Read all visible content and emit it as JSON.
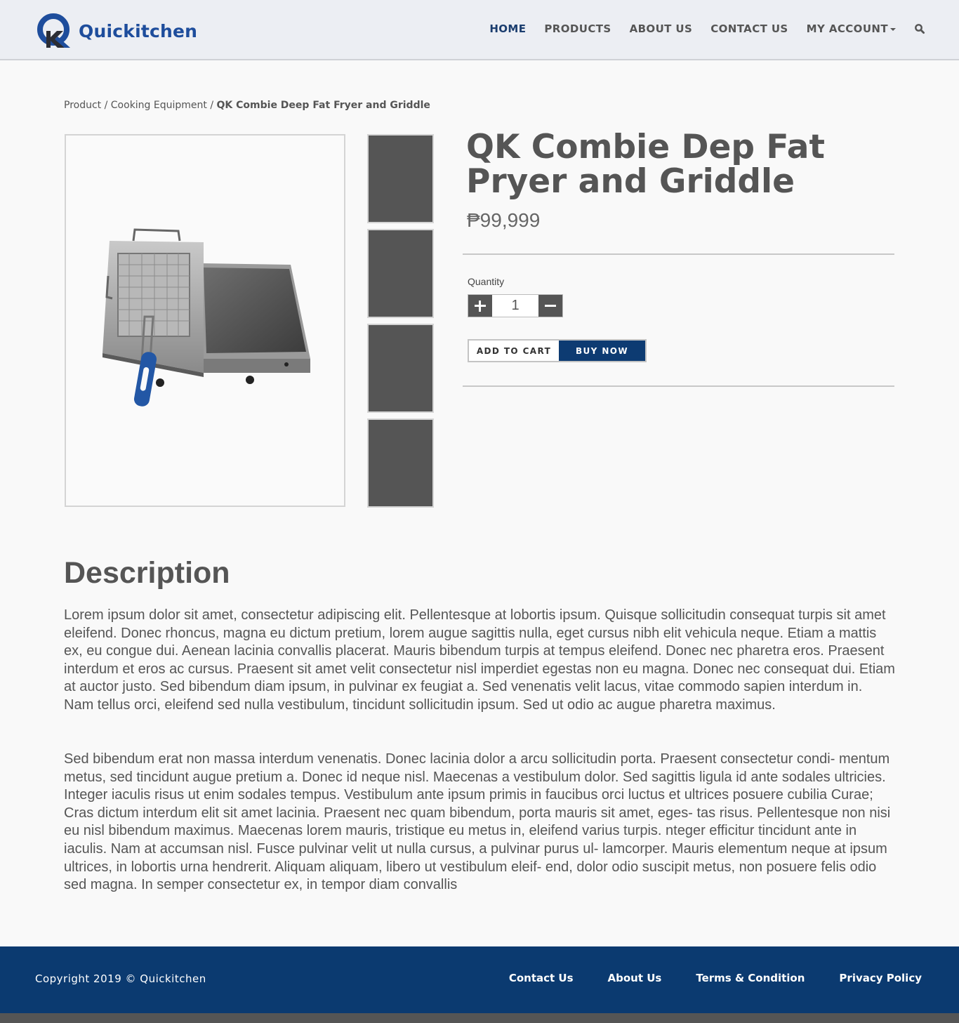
{
  "brand": {
    "name": "Quickitchen",
    "color": "#1e4d9c"
  },
  "nav": {
    "items": [
      {
        "label": "HOME",
        "active": true
      },
      {
        "label": "PRODUCTS"
      },
      {
        "label": "ABOUT US"
      },
      {
        "label": "CONTACT US"
      },
      {
        "label": "MY ACCOUNT"
      }
    ],
    "search_icon": "search-icon",
    "account_icon": "chevron-down-icon"
  },
  "breadcrumb": {
    "items": [
      "Product",
      "Cooking Equipment"
    ],
    "separator": "/",
    "current": "QK Combie Deep Fat Fryer and Griddle"
  },
  "product": {
    "title": "QK Combie Dep Fat Pryer and Griddle",
    "price": "₱99,999",
    "quantity_label": "Quantity",
    "quantity_value": "1",
    "add_to_cart_label": "ADD TO CART",
    "buy_now_label": "BUY NOW",
    "thumbnail_count": 4
  },
  "description": {
    "heading": "Description",
    "paragraphs": [
      "Lorem ipsum dolor sit amet, consectetur adipiscing elit. Pellentesque at lobortis ipsum. Quisque sollicitudin consequat turpis sit amet eleifend. Donec rhoncus, magna eu dictum pretium, lorem augue sagittis nulla, eget cursus nibh elit vehicula neque. Etiam a mattis ex, eu congue dui. Aenean lacinia convallis placerat. Mauris bibendum turpis at tempus eleifend. Donec nec pharetra eros. Praesent interdum et eros ac cursus. Praesent sit amet velit consectetur nisl imperdiet egestas non eu magna. Donec nec consequat dui. Etiam at auctor justo. Sed bibendum diam ipsum, in pulvinar ex feugiat a. Sed venenatis velit lacus, vitae commodo sapien interdum in. Nam tellus orci, eleifend sed nulla vestibulum, tincidunt sollicitudin ipsum. Sed ut odio ac augue pharetra maximus.",
      "Sed bibendum erat non massa interdum venenatis. Donec lacinia dolor a arcu sollicitudin porta. Praesent consectetur condi- mentum metus, sed tincidunt augue pretium a. Donec id neque nisl. Maecenas a vestibulum dolor. Sed sagittis ligula id ante sodales ultricies. Integer iaculis risus ut enim sodales tempus. Vestibulum ante ipsum primis in faucibus orci luctus et ultrices posuere cubilia Curae; Cras dictum interdum elit sit amet lacinia. Praesent nec quam bibendum, porta mauris sit amet, eges- tas risus. Pellentesque non nisi eu nisl bibendum maximus. Maecenas lorem mauris, tristique eu metus in, eleifend varius turpis. nteger efficitur tincidunt ante in iaculis. Nam at accumsan nisl. Fusce pulvinar velit ut nulla cursus, a pulvinar purus ul- lamcorper. Mauris elementum neque at ipsum ultrices, in lobortis urna hendrerit. Aliquam aliquam, libero ut vestibulum eleif- end, dolor odio suscipit metus, non posuere felis odio sed magna. In semper consectetur ex, in tempor diam convallis"
    ]
  },
  "footer": {
    "copyright": "Copyright 2019 © Quickitchen",
    "links": [
      "Contact Us",
      "About Us",
      "Terms & Condition",
      "Privacy Policy"
    ],
    "bg_color": "#0b3a70"
  },
  "colors": {
    "nav_active": "#1b3d6e",
    "buy_now": "#0d3b72",
    "thumb": "#555555"
  }
}
